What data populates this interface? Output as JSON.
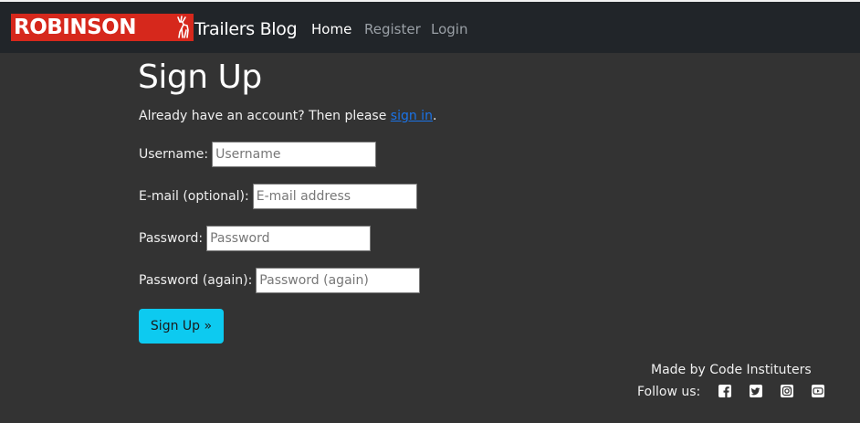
{
  "navbar": {
    "logo_text": "ROBINSON",
    "brand_text": "Trailers Blog",
    "links": [
      {
        "label": "Home"
      },
      {
        "label": "Register"
      },
      {
        "label": "Login"
      }
    ]
  },
  "main": {
    "title": "Sign Up",
    "intro_text": "Already have an account? Then please",
    "intro_link": "sign in",
    "intro_end": ".",
    "fields": [
      {
        "label": "Username:",
        "placeholder": "Username",
        "value": ""
      },
      {
        "label": "E-mail (optional):",
        "placeholder": "E-mail address",
        "value": ""
      },
      {
        "label": "Password:",
        "placeholder": "Password",
        "value": ""
      },
      {
        "label": "Password (again):",
        "placeholder": "Password (again)",
        "value": ""
      }
    ],
    "submit_label": "Sign Up »"
  },
  "footer": {
    "made_by": "Made by Code Instituters",
    "follow_label": "Follow us:",
    "social_icons": [
      "facebook-icon",
      "twitter-icon",
      "instagram-icon",
      "youtube-icon"
    ]
  },
  "colors": {
    "background": "#333333",
    "navbar": "#212529",
    "logo_red": "#d6281c",
    "link_blue": "#1a73e8",
    "button_cyan": "#0dcaf0"
  }
}
